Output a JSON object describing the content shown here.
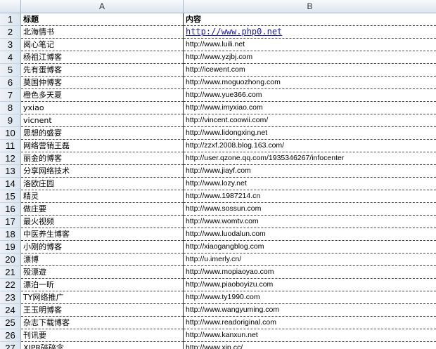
{
  "columns": {
    "a": "A",
    "b": "B"
  },
  "header": {
    "num": "1",
    "title": "标题",
    "content": "内容"
  },
  "rows": [
    {
      "num": "2",
      "title": "北海情书",
      "url": "http://www.php0.net"
    },
    {
      "num": "3",
      "title": "阅心笔记",
      "url": "http://www.luili.net"
    },
    {
      "num": "4",
      "title": "杨祖江博客",
      "url": "http://www.yzjbj.com"
    },
    {
      "num": "5",
      "title": "先有蛋博客",
      "url": "http://icewent.com"
    },
    {
      "num": "6",
      "title": "莫国仲博客",
      "url": "http://www.moguozhong.com"
    },
    {
      "num": "7",
      "title": "橙色多天夏",
      "url": "http://www.yue366.com"
    },
    {
      "num": "8",
      "title": "yxiao",
      "url": "http://www.imyxiao.com"
    },
    {
      "num": "9",
      "title": "vicnent",
      "url": "http://vincent.coowii.com/"
    },
    {
      "num": "10",
      "title": "思想的盛宴",
      "url": "http://www.lidongxing.net"
    },
    {
      "num": "11",
      "title": "网络营销王磊",
      "url": "http://zzxf.2008.blog.163.com/"
    },
    {
      "num": "12",
      "title": "丽金的博客",
      "url": "http://user.qzone.qq.com/1935346267/infocenter"
    },
    {
      "num": "13",
      "title": "分享网络技术",
      "url": "http://www.jiayf.com"
    },
    {
      "num": "14",
      "title": "洛欧庄园",
      "url": "http://www.lozy.net"
    },
    {
      "num": "15",
      "title": "精灵",
      "url": "http://www.1987214.cn"
    },
    {
      "num": "16",
      "title": "做庄要",
      "url": "http://www.sossun.com"
    },
    {
      "num": "17",
      "title": "最火视频",
      "url": "http://www.womtv.com"
    },
    {
      "num": "18",
      "title": "中医养生博客",
      "url": "http://www.luodalun.com"
    },
    {
      "num": "19",
      "title": "小刚的博客",
      "url": "http://xiaogangblog.com"
    },
    {
      "num": "20",
      "title": "漂博",
      "url": "http://u.imerly.cn/"
    },
    {
      "num": "21",
      "title": "殁漂遊",
      "url": "http://www.mopiaoyao.com"
    },
    {
      "num": "22",
      "title": "漂泊一昕",
      "url": "http://www.piaoboyizu.com"
    },
    {
      "num": "23",
      "title": "TY网络推广",
      "url": "http://www.ty1990.com"
    },
    {
      "num": "24",
      "title": "王玉明博客",
      "url": "http://www.wangyuming.com"
    },
    {
      "num": "25",
      "title": "杂志下载博客",
      "url": "http://www.readoriginal.com"
    },
    {
      "num": "26",
      "title": "刊讯要",
      "url": "http://www.kanxun.net"
    },
    {
      "num": "27",
      "title": "XJPR碎碎念",
      "url": "http://www.xjp.cc/"
    }
  ]
}
